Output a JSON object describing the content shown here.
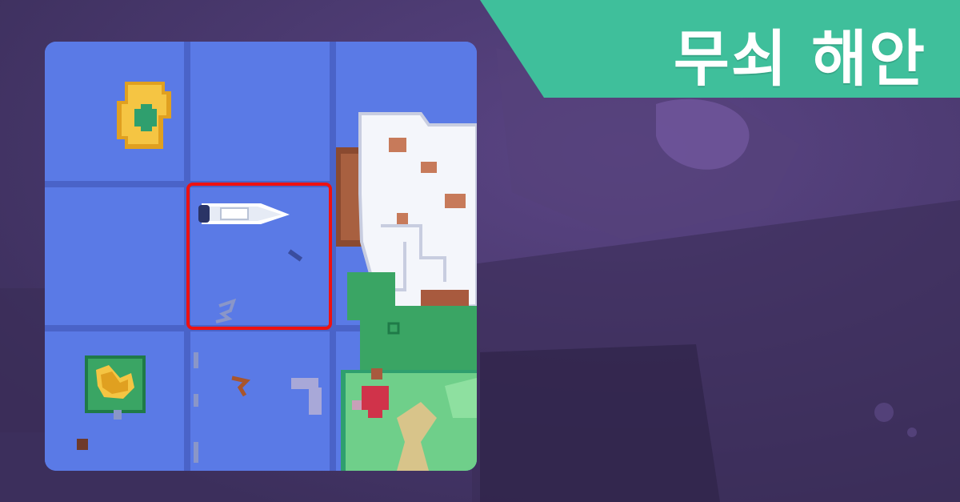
{
  "title": {
    "text": "무쇠 해안"
  },
  "colors": {
    "background": "#4a3a6e",
    "banner": "#3fbf9b",
    "sea": "#5a7ae6",
    "grid": "#4a63c8",
    "selection": "#ee1111"
  },
  "map": {
    "grid": {
      "rows": 3,
      "cols": 3
    },
    "selected_cell": {
      "row": 2,
      "col": 2
    },
    "features": [
      "sand-island-icon",
      "boat-icon",
      "jungle-island-icon",
      "snowy-mountain-icon",
      "grassland-icon",
      "red-marker-icon"
    ]
  }
}
